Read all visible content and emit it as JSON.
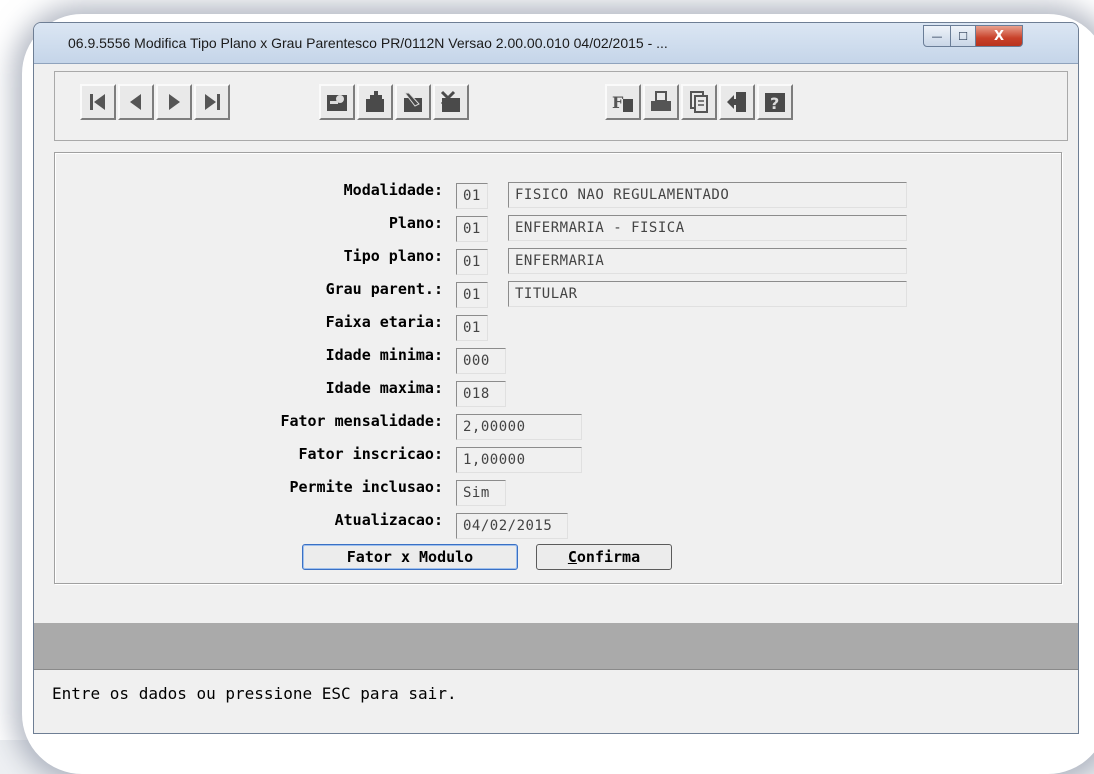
{
  "window": {
    "title": "06.9.5556  Modifica  Tipo Plano x Grau Parentesco PR/0112N Versao 2.00.00.010 04/02/2015 - ...",
    "min_glyph": "—",
    "max_glyph": "☐",
    "close_glyph": "X"
  },
  "toolbar": {
    "nav": [
      "first-record-icon",
      "previous-record-icon",
      "next-record-icon",
      "last-record-icon"
    ],
    "edit": [
      "search-key-icon",
      "add-record-icon",
      "edit-record-icon",
      "delete-record-icon"
    ],
    "misc": [
      "filter-icon",
      "print-icon",
      "copy-icon",
      "exit-icon",
      "help-icon"
    ]
  },
  "form": {
    "modalidade": {
      "label": "Modalidade:",
      "code": "01",
      "desc": "FISICO NAO REGULAMENTADO"
    },
    "plano": {
      "label": "Plano:",
      "code": "01",
      "desc": "ENFERMARIA - FISICA"
    },
    "tipo_plano": {
      "label": "Tipo plano:",
      "code": "01",
      "desc": "ENFERMARIA"
    },
    "grau_parent": {
      "label": "Grau parent.:",
      "code": "01",
      "desc": "TITULAR"
    },
    "faixa_etaria": {
      "label": "Faixa etaria:",
      "value": "01"
    },
    "idade_minima": {
      "label": "Idade minima:",
      "value": "000"
    },
    "idade_maxima": {
      "label": "Idade maxima:",
      "value": "018"
    },
    "fator_mensalidade": {
      "label": "Fator mensalidade:",
      "value": "2,00000"
    },
    "fator_inscricao": {
      "label": "Fator inscricao:",
      "value": "1,00000"
    },
    "permite_inclusao": {
      "label": "Permite inclusao:",
      "value": "Sim"
    },
    "atualizacao": {
      "label": "Atualizacao:",
      "value": "04/02/2015"
    }
  },
  "buttons": {
    "fator_modulo": "Fator x Modulo",
    "confirma_first": "C",
    "confirma_rest": "onfirma"
  },
  "status": {
    "message": "Entre os dados ou pressione ESC para sair."
  }
}
